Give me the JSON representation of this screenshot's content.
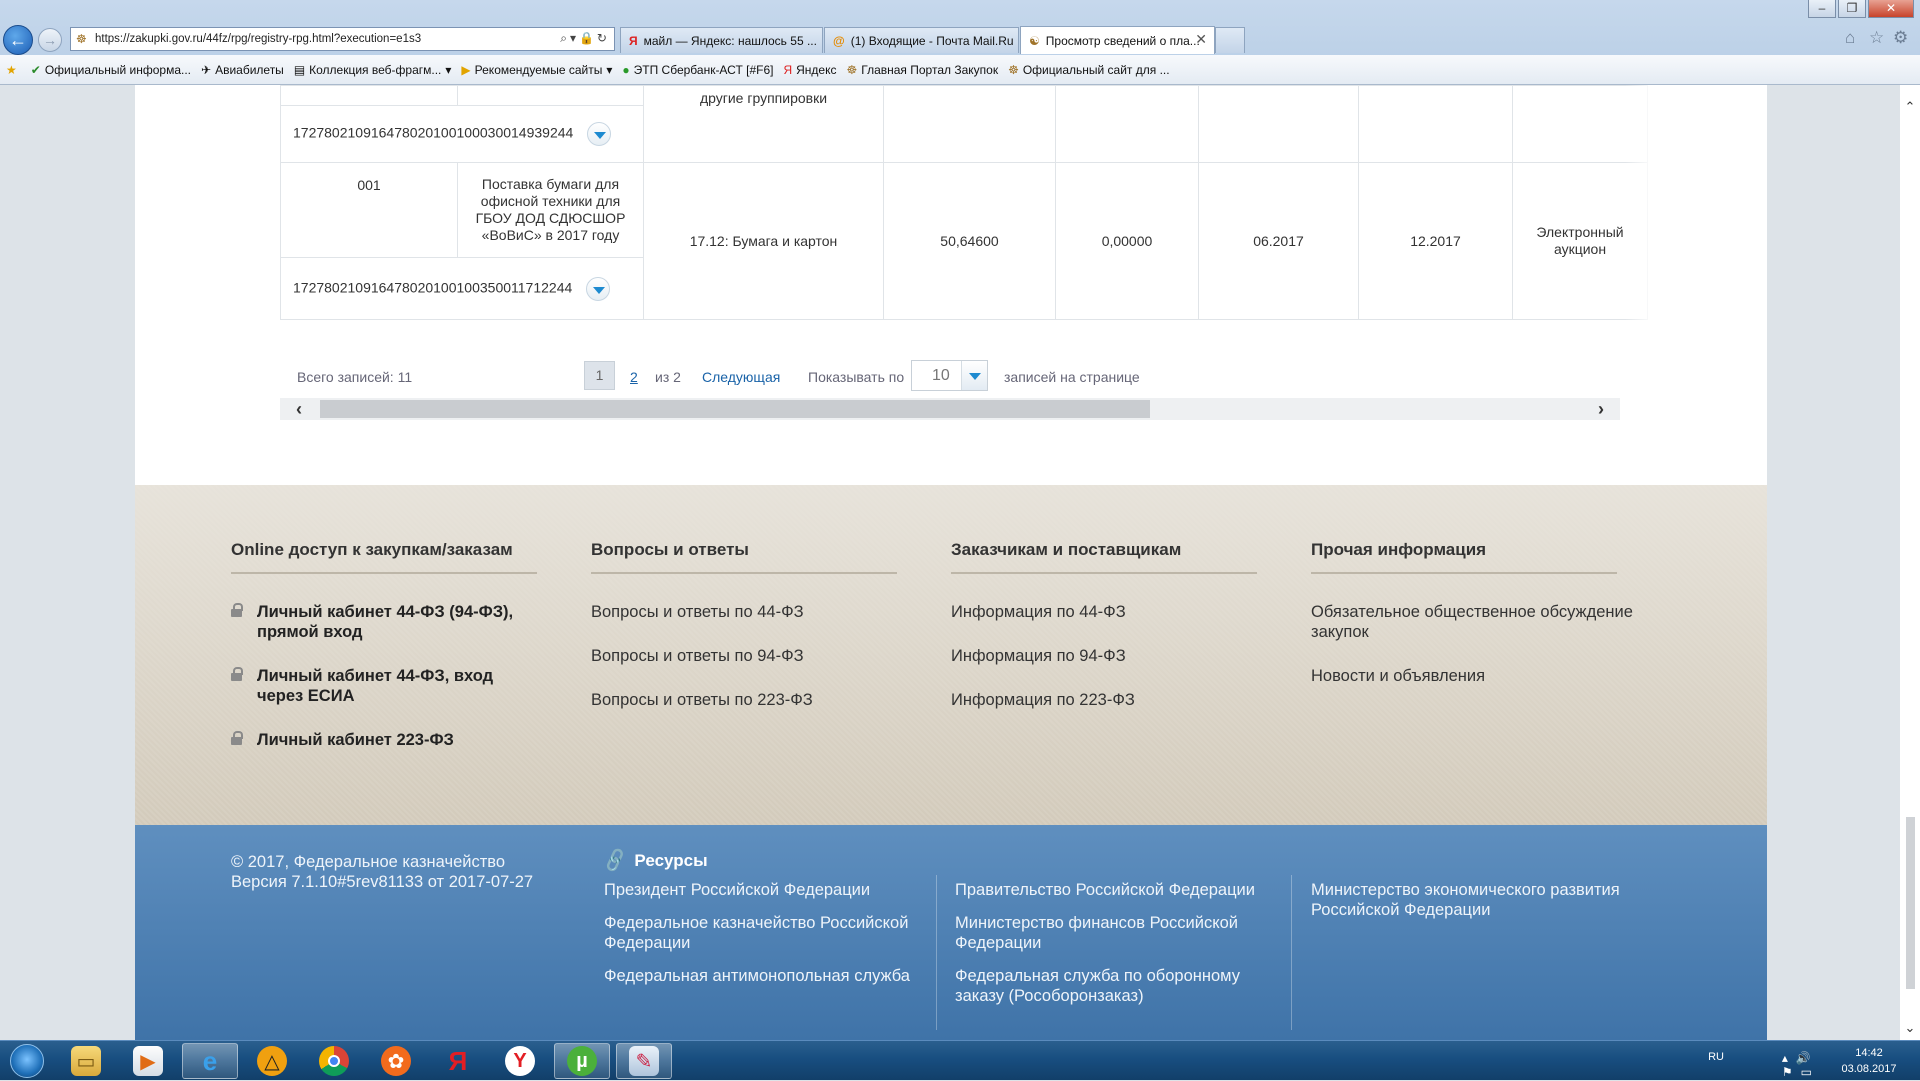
{
  "browser": {
    "address": "https://zakupki.gov.ru/44fz/rpg/registry-rpg.html?execution=e1s3",
    "tabs": [
      {
        "label": "майл — Яндекс: нашлось 55 ...",
        "icon": "Я"
      },
      {
        "label": "(1) Входящие - Почта Mail.Ru",
        "icon": "@"
      },
      {
        "label": "Просмотр сведений о пла...",
        "icon": "☯",
        "active": true
      }
    ],
    "favorites": [
      "Официальный информа...",
      "Авиабилеты",
      "Коллекция веб-фрагм...",
      "Рекомендуемые сайты",
      "ЭТП Сбербанк-АСТ [#F6]",
      "Яндекс",
      "Главная Портал Закупок",
      "Официальный сайт для ..."
    ]
  },
  "table": {
    "partial_row": {
      "category": "другие группировки",
      "ikz": "172780210916478020100100030014939244"
    },
    "row": {
      "num": "001",
      "name": "Поставка бумаги для офисной техники для ГБОУ ДОД СДЮСШОР «ВоВиС» в 2017 году",
      "okpd": "17.12: Бумага и картон",
      "amount": "50,64600",
      "amount2": "0,00000",
      "start": "06.2017",
      "end": "12.2017",
      "method": "Электронный аукцион",
      "ikz": "172780210916478020100100350011712244"
    }
  },
  "pager": {
    "total": "Всего записей: 11",
    "current": "1",
    "page2": "2",
    "of": "из 2",
    "next": "Следующая",
    "show_label": "Показывать по",
    "per_page": "10",
    "per_label": "записей на странице"
  },
  "footer": {
    "col1": {
      "title": "Online доступ к закупкам/заказам",
      "items": [
        "Личный кабинет 44-ФЗ (94-ФЗ), прямой вход",
        "Личный кабинет 44-ФЗ, вход через ЕСИА",
        "Личный кабинет 223-ФЗ"
      ]
    },
    "col2": {
      "title": "Вопросы и ответы",
      "items": [
        "Вопросы и ответы по 44-ФЗ",
        "Вопросы и ответы по 94-ФЗ",
        "Вопросы и ответы по 223-ФЗ"
      ]
    },
    "col3": {
      "title": "Заказчикам и поставщикам",
      "items": [
        "Информация по 44-ФЗ",
        "Информация по 94-ФЗ",
        "Информация по 223-ФЗ"
      ]
    },
    "col4": {
      "title": "Прочая информация",
      "items": [
        "Обязательное общественное обсуждение закупок",
        "Новости и объявления"
      ]
    },
    "copyright": "© 2017, Федеральное казначейство",
    "version": "Версия 7.1.10#5rev81133 от 2017-07-27",
    "resources_title": "Ресурсы",
    "res_col1": [
      "Президент Российской Федерации",
      "Федеральное казначейство Российской Федерации",
      "Федеральная антимонопольная служба"
    ],
    "res_col2": [
      "Правительство Российской Федерации",
      "Министерство финансов Российской Федерации",
      "Федеральная служба по оборонному заказу (Рособоронзаказ)"
    ],
    "res_col3": [
      "Министерство экономического развития Российской Федерации"
    ]
  },
  "taskbar": {
    "lang": "RU",
    "time": "14:42",
    "date": "03.08.2017"
  },
  "colors": {
    "link": "#1a63a8",
    "footer_blue": "#4a7db2",
    "dropdown_arrow": "#1d8ad0"
  }
}
